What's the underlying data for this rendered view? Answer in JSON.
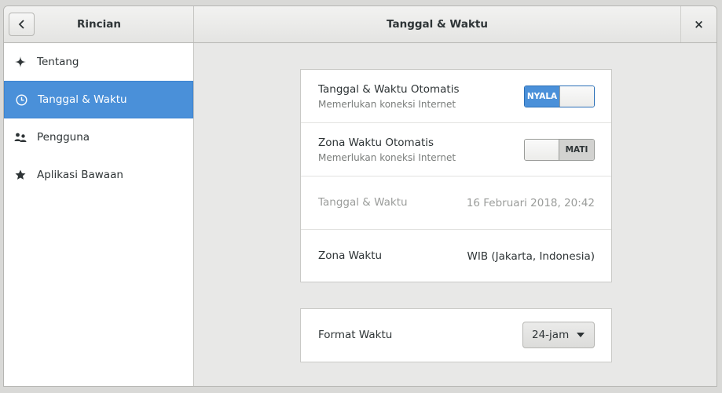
{
  "header": {
    "sidebar_title": "Rincian",
    "main_title": "Tanggal & Waktu",
    "close_label": "×"
  },
  "sidebar": {
    "items": [
      {
        "label": "Tentang",
        "icon": "sparkle-icon"
      },
      {
        "label": "Tanggal & Waktu",
        "icon": "clock-icon",
        "active": true
      },
      {
        "label": "Pengguna",
        "icon": "users-icon"
      },
      {
        "label": "Aplikasi Bawaan",
        "icon": "star-icon"
      }
    ]
  },
  "settings": {
    "auto_datetime": {
      "label": "Tanggal & Waktu Otomatis",
      "sub": "Memerlukan koneksi Internet",
      "switch_text": "NYALA",
      "state": "on"
    },
    "auto_timezone": {
      "label": "Zona Waktu Otomatis",
      "sub": "Memerlukan koneksi Internet",
      "switch_text": "MATI",
      "state": "off"
    },
    "datetime": {
      "label": "Tanggal & Waktu",
      "value": "16 Februari 2018, 20:42"
    },
    "timezone": {
      "label": "Zona Waktu",
      "value": "WIB (Jakarta, Indonesia)"
    },
    "time_format": {
      "label": "Format Waktu",
      "selected": "24-jam"
    }
  },
  "colors": {
    "accent": "#4a90d9",
    "window_bg": "#e8e8e7"
  }
}
